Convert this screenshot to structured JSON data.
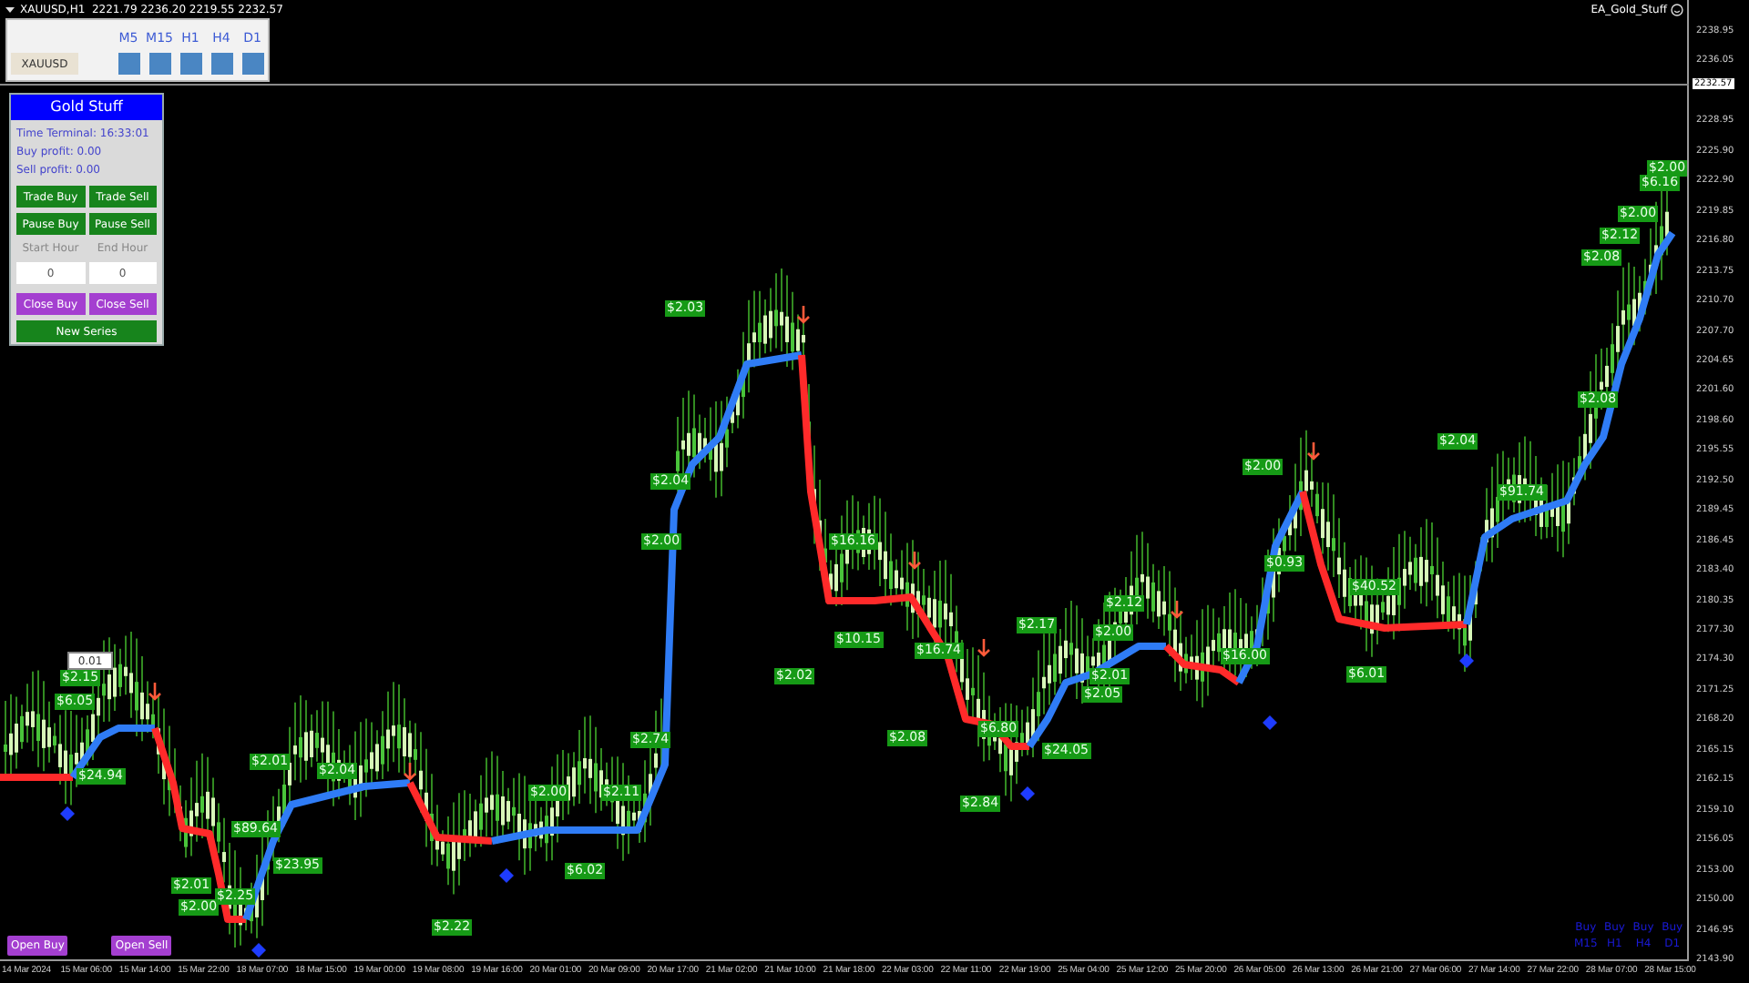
{
  "window": {
    "title": "XAUUSD,H1  2221.79 2236.20 2219.55 2232.57",
    "expert": "EA_Gold_Stuff"
  },
  "timeframe_panel": {
    "symbol": "XAUUSD",
    "timeframes": [
      {
        "label": "M5"
      },
      {
        "label": "M15"
      },
      {
        "label": "H1"
      },
      {
        "label": "H4"
      },
      {
        "label": "D1"
      }
    ]
  },
  "control_panel": {
    "title": "Gold Stuff",
    "time_terminal": "Time Terminal: 16:33:01",
    "buy_profit": "Buy profit: 0.00",
    "sell_profit": "Sell profit: 0.00",
    "trade_buttons": [
      "Trade Buy",
      "Trade Sell",
      "Pause Buy",
      "Pause Sell"
    ],
    "hours": [
      {
        "label": "Start Hour",
        "value": "0"
      },
      {
        "label": "End Hour",
        "value": "0"
      }
    ],
    "close_buttons": [
      "Close Buy",
      "Close Sell"
    ],
    "new_series": "New Series"
  },
  "lot_field": {
    "value": "0.01"
  },
  "trade_labels": [
    "$2.15",
    "$6.05",
    "$24.94",
    "$2.01",
    "$2.04",
    "$89.64",
    "$23.95",
    "$2.01",
    "$2.25",
    "$2.00",
    "$2.22",
    "$2.00",
    "$6.02",
    "$2.11",
    "$2.74",
    "$2.04",
    "$2.00",
    "$2.03",
    "$2.02",
    "$16.16",
    "$10.15",
    "$16.74",
    "$2.08",
    "$6.80",
    "$2.84",
    "$2.17",
    "$2.12",
    "$2.00",
    "$2.01",
    "$2.05",
    "$24.05",
    "$16.00",
    "$2.00",
    "$0.93",
    "$6.01",
    "$40.52",
    "$2.04",
    "$91.74",
    "$2.08",
    "$2.08",
    "$2.12",
    "$2.00",
    "$6.16",
    "$2.00"
  ],
  "chart_buttons": [
    "Open Buy",
    "Open Sell"
  ],
  "signal_grid": [
    [
      "Buy",
      "Buy",
      "Buy",
      "Buy"
    ],
    [
      "M15",
      "H1",
      "H4",
      "D1"
    ]
  ],
  "price_axis": {
    "ticks": [
      "2238.95",
      "2236.05",
      "2228.95",
      "2225.90",
      "2222.90",
      "2219.85",
      "2216.80",
      "2213.75",
      "2210.70",
      "2207.70",
      "2204.65",
      "2201.60",
      "2198.60",
      "2195.55",
      "2192.50",
      "2189.45",
      "2186.45",
      "2183.40",
      "2180.35",
      "2177.30",
      "2174.30",
      "2171.25",
      "2168.20",
      "2165.15",
      "2162.15",
      "2159.10",
      "2156.05",
      "2153.00",
      "2150.00",
      "2146.95",
      "2143.90"
    ],
    "current_price": "2232.57"
  },
  "time_axis": {
    "ticks": [
      "14 Mar 2024",
      "15 Mar 06:00",
      "15 Mar 14:00",
      "15 Mar 22:00",
      "18 Mar 07:00",
      "18 Mar 15:00",
      "19 Mar 00:00",
      "19 Mar 08:00",
      "19 Mar 16:00",
      "20 Mar 01:00",
      "20 Mar 09:00",
      "20 Mar 17:00",
      "21 Mar 02:00",
      "21 Mar 10:00",
      "21 Mar 18:00",
      "22 Mar 03:00",
      "22 Mar 11:00",
      "22 Mar 19:00",
      "25 Mar 04:00",
      "25 Mar 12:00",
      "25 Mar 20:00",
      "26 Mar 05:00",
      "26 Mar 13:00",
      "26 Mar 21:00",
      "27 Mar 06:00",
      "27 Mar 14:00",
      "27 Mar 22:00",
      "28 Mar 07:00",
      "28 Mar 15:00"
    ]
  }
}
